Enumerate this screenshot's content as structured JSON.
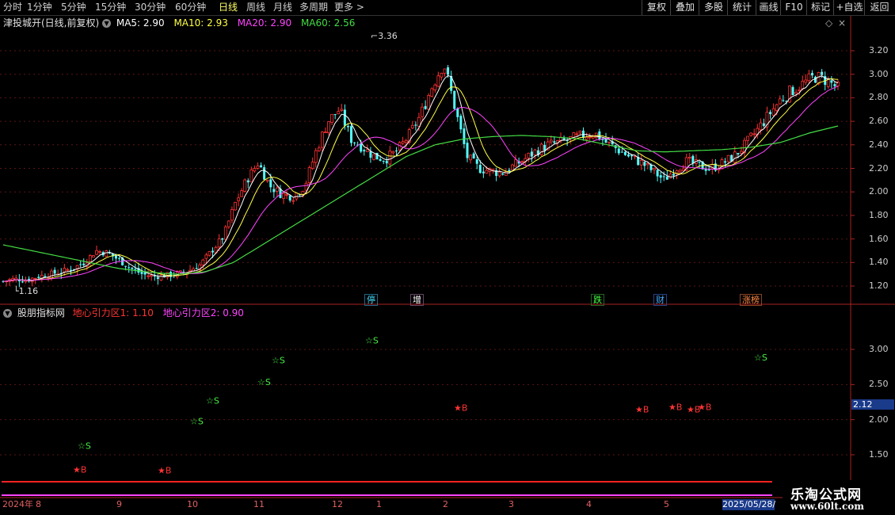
{
  "toolbar": {
    "timeframes": [
      "分时",
      "1分钟",
      "5分钟",
      "15分钟",
      "30分钟",
      "60分钟",
      "日线",
      "周线",
      "月线",
      "多周期",
      "更多"
    ],
    "active_index": 6,
    "more_arrow": ">",
    "buttons": [
      "复权",
      "叠加",
      "多股",
      "统计",
      "画线",
      "F10",
      "+自选",
      "返回"
    ]
  },
  "main_chart": {
    "title": "津投城开(日线,前复权)",
    "ma": [
      {
        "label": "MA5: 2.90",
        "color": "#ffffff"
      },
      {
        "label": "MA10: 2.93",
        "color": "#ffff44"
      },
      {
        "label": "MA20: 2.90",
        "color": "#ff44ff"
      },
      {
        "label": "MA60: 2.56",
        "color": "#44dd44"
      }
    ],
    "y_ticks": [
      "3.20",
      "3.00",
      "2.80",
      "2.60",
      "2.40",
      "2.20",
      "2.00",
      "1.80",
      "1.60",
      "1.40",
      "1.20"
    ],
    "high_label": "3.36",
    "low_label": "1.16",
    "tags": [
      {
        "text": "停",
        "color": "#44ddff"
      },
      {
        "text": "增",
        "color": "#ffffff"
      },
      {
        "text": "跌",
        "color": "#44ff44"
      },
      {
        "text": "财",
        "color": "#44aaff"
      },
      {
        "text": "涨榜",
        "color": "#ff8844"
      }
    ]
  },
  "indicator": {
    "name": "股朋指标网",
    "line1": "地心引力区1: 1.10",
    "line2": "地心引力区2: 0.90",
    "line1_color": "#ff3333",
    "line2_color": "#ff44ff",
    "y_ticks": [
      "3.00",
      "2.50",
      "2.00",
      "1.50"
    ],
    "current_price": "2.12",
    "sell_label": "☆S",
    "buy_label": "★B"
  },
  "time_axis": {
    "labels": [
      "2024年",
      "8",
      "9",
      "10",
      "11",
      "12",
      "1",
      "2",
      "3",
      "4",
      "5"
    ],
    "current_date": "2025/05/28/"
  },
  "brand": {
    "name": "乐淘公式网",
    "url": "www.60lt.com"
  },
  "chart_data": {
    "type": "candlestick",
    "title": "",
    "y_range_main": [
      1.1,
      3.4
    ],
    "y_range_indicator": [
      1.3,
      3.4
    ],
    "ohlc_close_approx": [
      1.24,
      1.26,
      1.25,
      1.28,
      1.3,
      1.32,
      1.35,
      1.4,
      1.5,
      1.48,
      1.42,
      1.35,
      1.3,
      1.28,
      1.29,
      1.3,
      1.33,
      1.38,
      1.5,
      1.62,
      1.9,
      2.1,
      2.25,
      2.05,
      1.98,
      1.96,
      2.05,
      2.35,
      2.6,
      2.7,
      2.45,
      2.38,
      2.3,
      2.28,
      2.35,
      2.48,
      2.65,
      2.9,
      3.1,
      2.7,
      2.3,
      2.2,
      2.18,
      2.16,
      2.22,
      2.28,
      2.35,
      2.4,
      2.42,
      2.45,
      2.48,
      2.5,
      2.42,
      2.36,
      2.3,
      2.25,
      2.18,
      2.1,
      2.2,
      2.26,
      2.22,
      2.2,
      2.24,
      2.3,
      2.4,
      2.52,
      2.65,
      2.78,
      2.86,
      2.92,
      2.98,
      2.95,
      2.88
    ],
    "ma60_approx": [
      1.55,
      1.5,
      1.45,
      1.4,
      1.35,
      1.32,
      1.3,
      1.32,
      1.4,
      1.55,
      1.7,
      1.85,
      2.0,
      2.15,
      2.3,
      2.4,
      2.45,
      2.47,
      2.48,
      2.47,
      2.45,
      2.4,
      2.35,
      2.34,
      2.35,
      2.36,
      2.38,
      2.42,
      2.5,
      2.56
    ],
    "sell_signals": [
      1.63,
      1.98,
      2.27,
      2.54,
      2.85,
      3.13,
      2.89
    ],
    "buy_signals": [
      1.29,
      1.28,
      2.17,
      2.15,
      2.18,
      2.15,
      2.18
    ]
  }
}
